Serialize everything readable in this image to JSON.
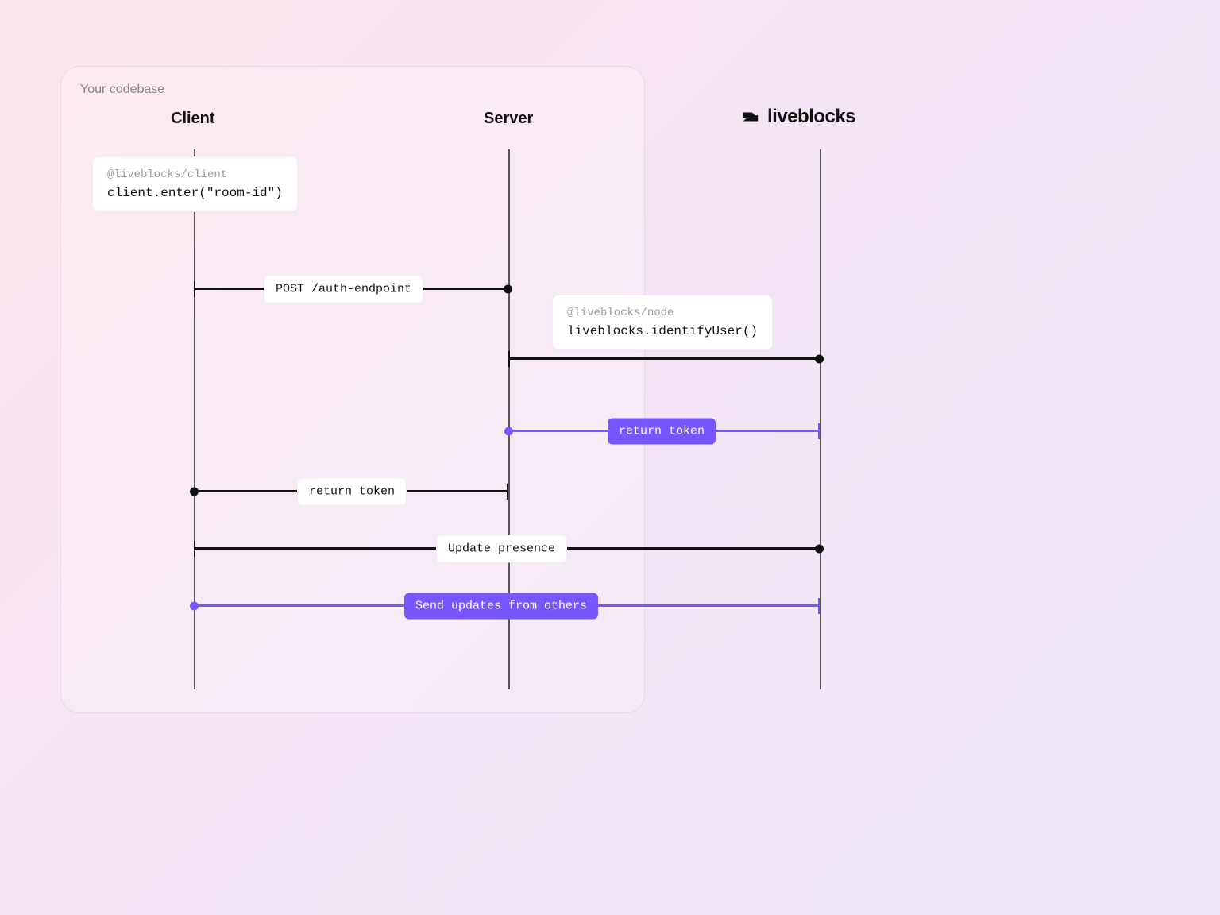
{
  "codebase_label": "Your codebase",
  "headings": {
    "client": "Client",
    "server": "Server"
  },
  "brand": "liveblocks",
  "code_boxes": {
    "client": {
      "pkg": "@liveblocks/client",
      "code": "client.enter(\"room-id\")"
    },
    "server": {
      "pkg": "@liveblocks/node",
      "code": "liveblocks.identifyUser()"
    }
  },
  "arrows": {
    "post_auth": "POST /auth-endpoint",
    "return_token_serv": "return token",
    "return_token_client": "return token",
    "update_presence": "Update presence",
    "send_updates": "Send updates from others"
  }
}
